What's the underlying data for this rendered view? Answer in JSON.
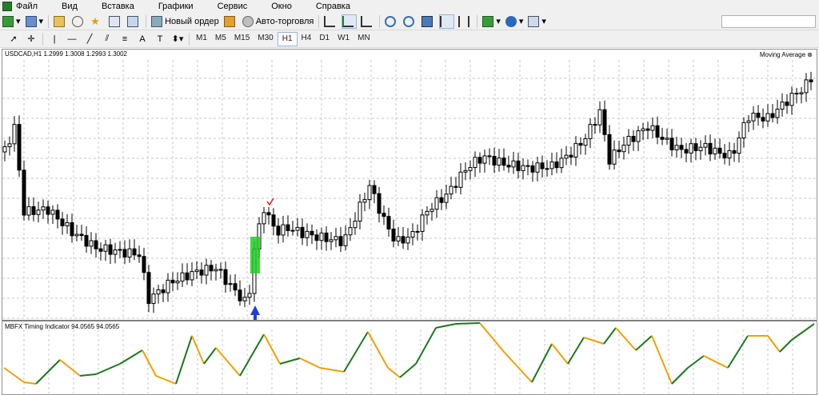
{
  "menu": [
    "Файл",
    "Вид",
    "Вставка",
    "Графики",
    "Сервис",
    "Окно",
    "Справка"
  ],
  "toolbar": {
    "new_order_label": "Новый ордер",
    "auto_trading_label": "Авто-торговля",
    "timeframes": [
      "M1",
      "M5",
      "M15",
      "M30",
      "H1",
      "H4",
      "D1",
      "W1",
      "MN"
    ],
    "active_timeframe": "H1",
    "text_tool": "A"
  },
  "chart": {
    "header": "USDCAD,H1  1.2999 1.3008 1.2993 1.3002",
    "overlay_indicator": "Moving Average",
    "subwindow_header": "MBFX Timing Indicator 94.0565 94.0565",
    "colors": {
      "bull_body": "#ffffff",
      "bear_body": "#000000",
      "grid": "#c8c8c8",
      "osc_up": "#1a7a1a",
      "osc_down": "#f0a000",
      "highlight": "#22cc22",
      "arrow": "#1f3fd6"
    }
  }
}
